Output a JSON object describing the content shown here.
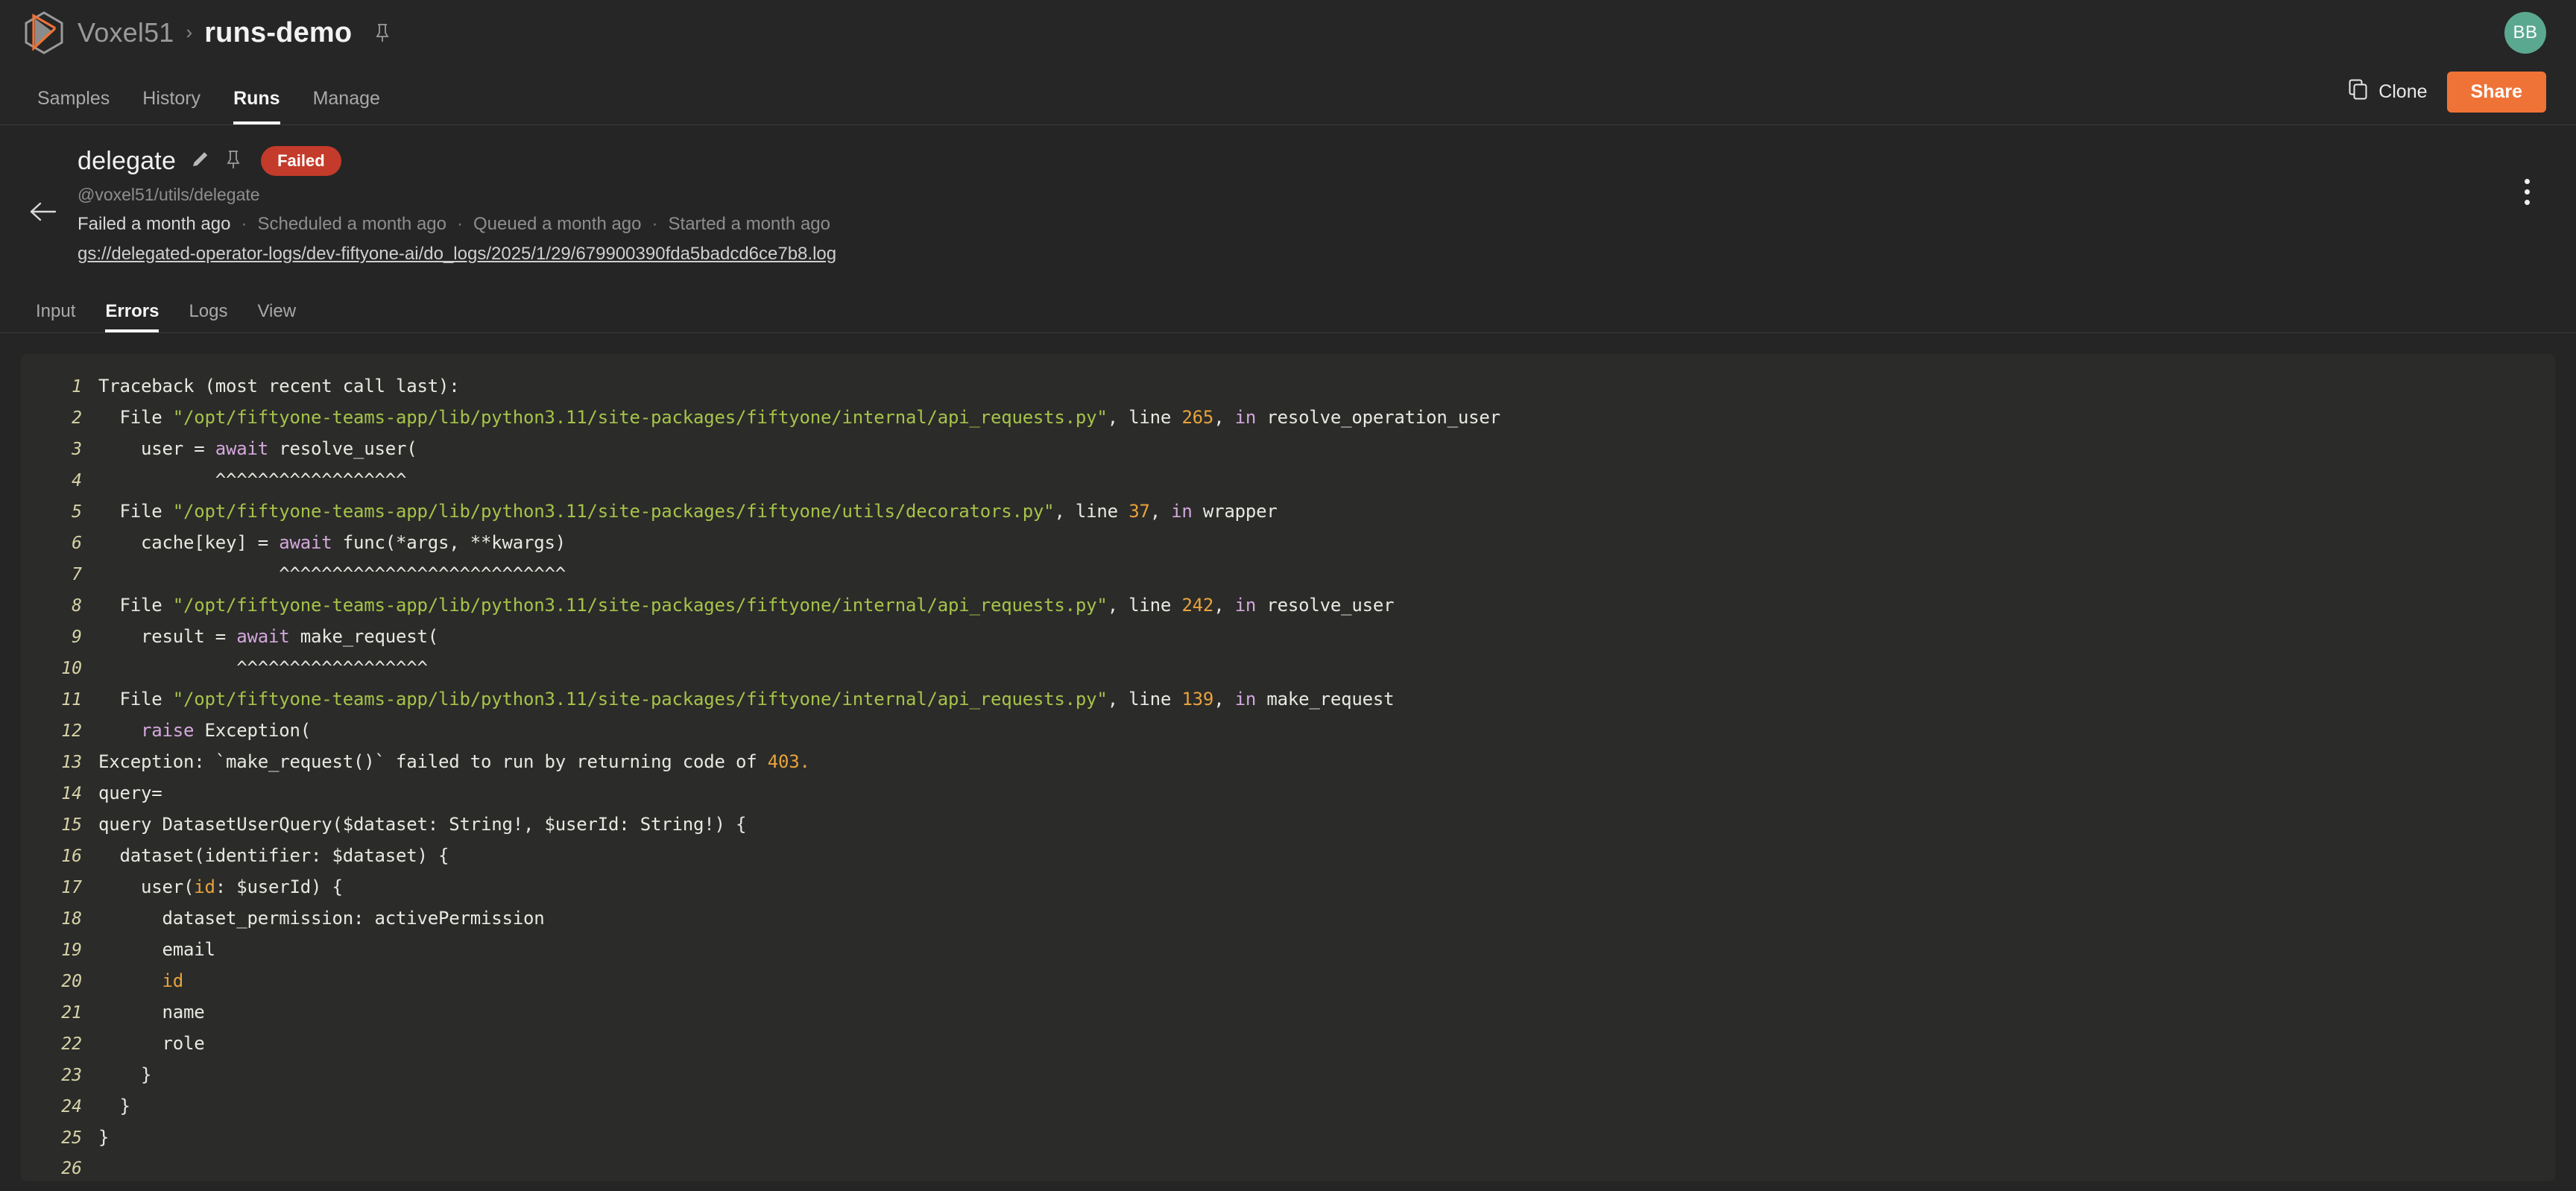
{
  "topbar": {
    "logo_icon": "voxel51-logo-icon",
    "breadcrumb": {
      "org": "Voxel51",
      "separator": "›",
      "current": "runs-demo",
      "pin_icon": "pin-icon"
    },
    "avatar_initials": "BB",
    "avatar_color": "#5ba891"
  },
  "nav": {
    "tabs": [
      {
        "label": "Samples",
        "active": false
      },
      {
        "label": "History",
        "active": false
      },
      {
        "label": "Runs",
        "active": true
      },
      {
        "label": "Manage",
        "active": false
      }
    ],
    "clone_label": "Clone",
    "clone_icon": "copy-icon",
    "share_label": "Share",
    "share_color": "#ef7337"
  },
  "run": {
    "back_icon": "back-arrow-icon",
    "title": "delegate",
    "edit_icon": "pencil-icon",
    "pin_icon": "pin-icon",
    "status": "Failed",
    "status_color": "#c43b2b",
    "operator_uri": "@voxel51/utils/delegate",
    "meta": [
      {
        "text": "Failed a month ago",
        "emphasis": true
      },
      {
        "text": "Scheduled a month ago",
        "emphasis": false
      },
      {
        "text": "Queued a month ago",
        "emphasis": false
      },
      {
        "text": "Started a month ago",
        "emphasis": false
      }
    ],
    "meta_separator": "·",
    "log_link": "gs://delegated-operator-logs/dev-fiftyone-ai/do_logs/2025/1/29/679900390fda5badcd6ce7b8.log",
    "kebab_icon": "more-vertical-icon"
  },
  "subtabs": [
    {
      "label": "Input",
      "active": false
    },
    {
      "label": "Errors",
      "active": true
    },
    {
      "label": "Logs",
      "active": false
    },
    {
      "label": "View",
      "active": false
    }
  ],
  "code": {
    "lines": [
      {
        "n": "1",
        "segments": [
          {
            "t": "Traceback (most recent call last):",
            "c": ""
          }
        ]
      },
      {
        "n": "2",
        "segments": [
          {
            "t": "  File ",
            "c": ""
          },
          {
            "t": "\"/opt/fiftyone-teams-app/lib/python3.11/site-packages/fiftyone/internal/api_requests.py\"",
            "c": "tok-str"
          },
          {
            "t": ", line ",
            "c": ""
          },
          {
            "t": "265",
            "c": "tok-num"
          },
          {
            "t": ", ",
            "c": ""
          },
          {
            "t": "in",
            "c": "tok-kw"
          },
          {
            "t": " resolve_operation_user",
            "c": ""
          }
        ]
      },
      {
        "n": "3",
        "segments": [
          {
            "t": "    user = ",
            "c": ""
          },
          {
            "t": "await",
            "c": "tok-kw"
          },
          {
            "t": " resolve_user(",
            "c": ""
          }
        ]
      },
      {
        "n": "4",
        "segments": [
          {
            "t": "           ^^^^^^^^^^^^^^^^^^",
            "c": ""
          }
        ]
      },
      {
        "n": "5",
        "segments": [
          {
            "t": "  File ",
            "c": ""
          },
          {
            "t": "\"/opt/fiftyone-teams-app/lib/python3.11/site-packages/fiftyone/utils/decorators.py\"",
            "c": "tok-str"
          },
          {
            "t": ", line ",
            "c": ""
          },
          {
            "t": "37",
            "c": "tok-num"
          },
          {
            "t": ", ",
            "c": ""
          },
          {
            "t": "in",
            "c": "tok-kw"
          },
          {
            "t": " wrapper",
            "c": ""
          }
        ]
      },
      {
        "n": "6",
        "segments": [
          {
            "t": "    cache[key] = ",
            "c": ""
          },
          {
            "t": "await",
            "c": "tok-kw"
          },
          {
            "t": " func(*args, **kwargs)",
            "c": ""
          }
        ]
      },
      {
        "n": "7",
        "segments": [
          {
            "t": "                 ^^^^^^^^^^^^^^^^^^^^^^^^^^^",
            "c": ""
          }
        ]
      },
      {
        "n": "8",
        "segments": [
          {
            "t": "  File ",
            "c": ""
          },
          {
            "t": "\"/opt/fiftyone-teams-app/lib/python3.11/site-packages/fiftyone/internal/api_requests.py\"",
            "c": "tok-str"
          },
          {
            "t": ", line ",
            "c": ""
          },
          {
            "t": "242",
            "c": "tok-num"
          },
          {
            "t": ", ",
            "c": ""
          },
          {
            "t": "in",
            "c": "tok-kw"
          },
          {
            "t": " resolve_user",
            "c": ""
          }
        ]
      },
      {
        "n": "9",
        "segments": [
          {
            "t": "    result = ",
            "c": ""
          },
          {
            "t": "await",
            "c": "tok-kw"
          },
          {
            "t": " make_request(",
            "c": ""
          }
        ]
      },
      {
        "n": "10",
        "segments": [
          {
            "t": "             ^^^^^^^^^^^^^^^^^^",
            "c": ""
          }
        ]
      },
      {
        "n": "11",
        "segments": [
          {
            "t": "  File ",
            "c": ""
          },
          {
            "t": "\"/opt/fiftyone-teams-app/lib/python3.11/site-packages/fiftyone/internal/api_requests.py\"",
            "c": "tok-str"
          },
          {
            "t": ", line ",
            "c": ""
          },
          {
            "t": "139",
            "c": "tok-num"
          },
          {
            "t": ", ",
            "c": ""
          },
          {
            "t": "in",
            "c": "tok-kw"
          },
          {
            "t": " make_request",
            "c": ""
          }
        ]
      },
      {
        "n": "12",
        "segments": [
          {
            "t": "    ",
            "c": ""
          },
          {
            "t": "raise",
            "c": "tok-kw"
          },
          {
            "t": " Exception(",
            "c": ""
          }
        ]
      },
      {
        "n": "13",
        "segments": [
          {
            "t": "Exception: `make_request()` failed to run by returning code of ",
            "c": ""
          },
          {
            "t": "403.",
            "c": "tok-num"
          }
        ]
      },
      {
        "n": "14",
        "segments": [
          {
            "t": "query=",
            "c": ""
          }
        ]
      },
      {
        "n": "15",
        "segments": [
          {
            "t": "query DatasetUserQuery($dataset: String!, $userId: String!) {",
            "c": ""
          }
        ]
      },
      {
        "n": "16",
        "segments": [
          {
            "t": "  dataset(identifier: $dataset) {",
            "c": ""
          }
        ]
      },
      {
        "n": "17",
        "segments": [
          {
            "t": "    user(",
            "c": ""
          },
          {
            "t": "id",
            "c": "tok-id"
          },
          {
            "t": ": $userId) {",
            "c": ""
          }
        ]
      },
      {
        "n": "18",
        "segments": [
          {
            "t": "      dataset_permission: activePermission",
            "c": ""
          }
        ]
      },
      {
        "n": "19",
        "segments": [
          {
            "t": "      email",
            "c": ""
          }
        ]
      },
      {
        "n": "20",
        "segments": [
          {
            "t": "      ",
            "c": ""
          },
          {
            "t": "id",
            "c": "tok-id"
          }
        ]
      },
      {
        "n": "21",
        "segments": [
          {
            "t": "      name",
            "c": ""
          }
        ]
      },
      {
        "n": "22",
        "segments": [
          {
            "t": "      role",
            "c": ""
          }
        ]
      },
      {
        "n": "23",
        "segments": [
          {
            "t": "    }",
            "c": ""
          }
        ]
      },
      {
        "n": "24",
        "segments": [
          {
            "t": "  }",
            "c": ""
          }
        ]
      },
      {
        "n": "25",
        "segments": [
          {
            "t": "}",
            "c": ""
          }
        ]
      },
      {
        "n": "26",
        "segments": [
          {
            "t": "",
            "c": ""
          }
        ]
      }
    ]
  }
}
